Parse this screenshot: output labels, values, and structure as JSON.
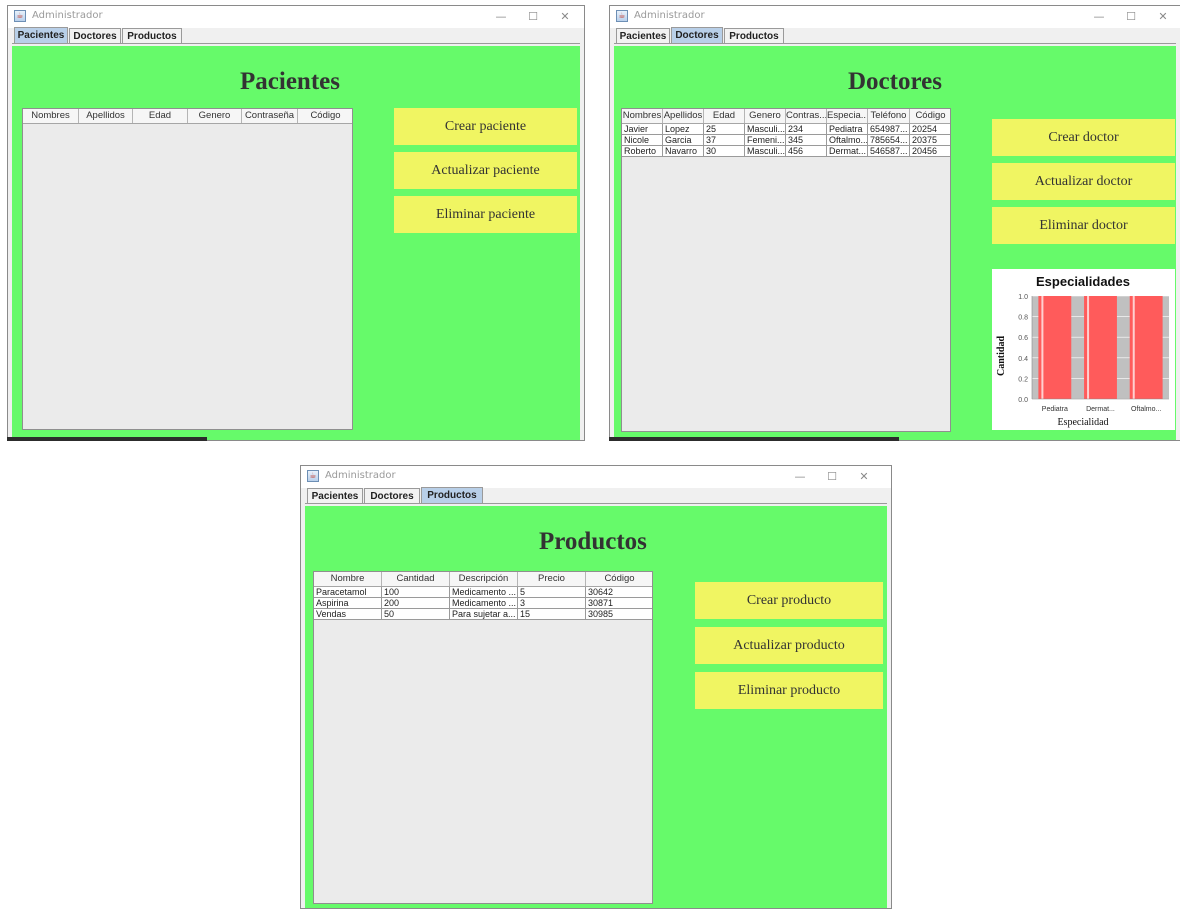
{
  "window_title": "Administrador",
  "window_controls": {
    "minimize": "—",
    "maximize": "☐",
    "close": "✕"
  },
  "tabs": [
    "Pacientes",
    "Doctores",
    "Productos"
  ],
  "colors": {
    "panel": "#66fa6a",
    "button": "#f0f562",
    "bar": "#ff5b5b",
    "active_tab": "#b8cfe8"
  },
  "pacientes": {
    "heading": "Pacientes",
    "columns": [
      "Nombres",
      "Apellidos",
      "Edad",
      "Genero",
      "Contraseña",
      "Código"
    ],
    "rows": [],
    "buttons": [
      "Crear paciente",
      "Actualizar paciente",
      "Eliminar paciente"
    ]
  },
  "doctores": {
    "heading": "Doctores",
    "columns": [
      "Nombres",
      "Apellidos",
      "Edad",
      "Genero",
      "Contras...",
      "Especia...",
      "Teléfono",
      "Código"
    ],
    "rows": [
      [
        "Javier",
        "Lopez",
        "25",
        "Masculi...",
        "234",
        "Pediatra",
        "654987...",
        "20254"
      ],
      [
        "Nicole",
        "Garcia",
        "37",
        "Femeni...",
        "345",
        "Oftalmo...",
        "785654...",
        "20375"
      ],
      [
        "Roberto",
        "Navarro",
        "30",
        "Masculi...",
        "456",
        "Dermat...",
        "546587...",
        "20456"
      ]
    ],
    "buttons": [
      "Crear doctor",
      "Actualizar doctor",
      "Eliminar doctor"
    ],
    "chart_data": {
      "type": "bar",
      "title": "Especialidades",
      "xlabel": "Especialidad",
      "ylabel": "Cantidad",
      "categories": [
        "Pediatra",
        "Dermat...",
        "Oftalmo..."
      ],
      "values": [
        1.0,
        1.0,
        1.0
      ],
      "ylim": [
        0,
        1.0
      ],
      "yticks": [
        "0.0",
        "0.2",
        "0.4",
        "0.6",
        "0.8",
        "1.0"
      ],
      "grid": true
    }
  },
  "productos": {
    "heading": "Productos",
    "columns": [
      "Nombre",
      "Cantidad",
      "Descripción",
      "Precio",
      "Código"
    ],
    "rows": [
      [
        "Paracetamol",
        "100",
        "Medicamento ...",
        "5",
        "30642"
      ],
      [
        "Aspirina",
        "200",
        "Medicamento ...",
        "3",
        "30871"
      ],
      [
        "Vendas",
        "50",
        "Para sujetar a...",
        "15",
        "30985"
      ]
    ],
    "buttons": [
      "Crear producto",
      "Actualizar producto",
      "Eliminar producto"
    ]
  }
}
